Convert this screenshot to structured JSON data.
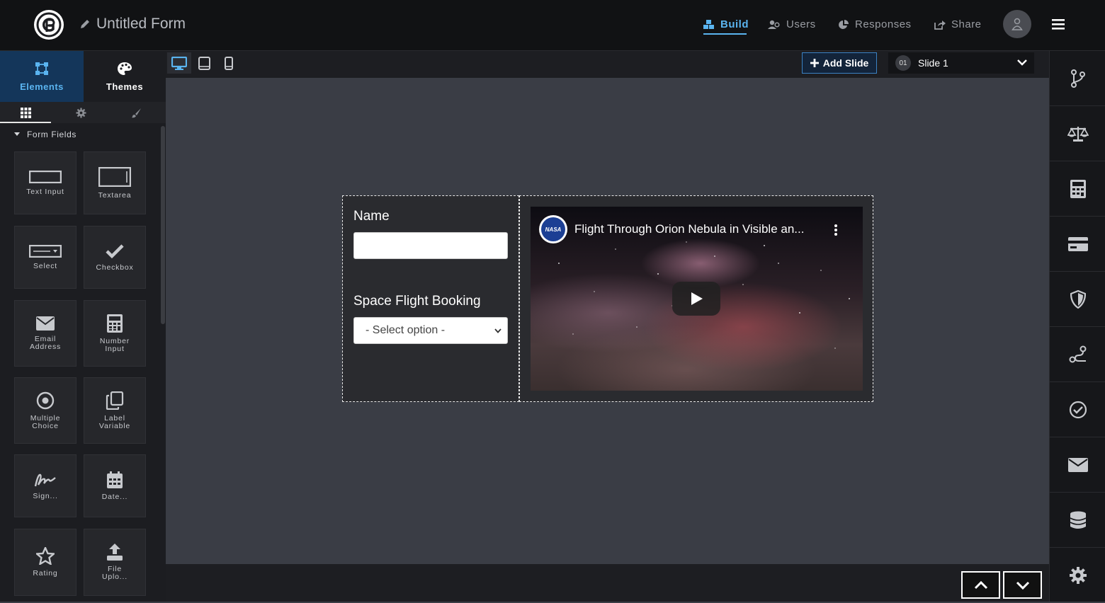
{
  "app": {
    "form_title": "Untitled Form",
    "logo_text": "GP"
  },
  "topnav": {
    "build": "Build",
    "users": "Users",
    "responses": "Responses",
    "share": "Share"
  },
  "left_panel": {
    "tabs": {
      "elements": "Elements",
      "themes": "Themes"
    },
    "section_title": "Form Fields",
    "tiles": [
      {
        "label": "Text Input",
        "icon": "text-input-icon"
      },
      {
        "label": "Textarea",
        "icon": "textarea-icon"
      },
      {
        "label": "Select",
        "icon": "select-icon"
      },
      {
        "label": "Checkbox",
        "icon": "checkbox-icon"
      },
      {
        "label": "Email Address",
        "icon": "email-icon"
      },
      {
        "label": "Number Input",
        "icon": "calculator-icon"
      },
      {
        "label": "Multiple Choice",
        "icon": "radio-icon"
      },
      {
        "label": "Label Variable",
        "icon": "copy-icon"
      },
      {
        "label": "Sign...",
        "icon": "signature-icon"
      },
      {
        "label": "Date...",
        "icon": "calendar-icon"
      },
      {
        "label": "Rating",
        "icon": "star-icon"
      },
      {
        "label": "File Uplo...",
        "icon": "upload-icon"
      }
    ]
  },
  "toolbar": {
    "add_slide": "Add Slide",
    "slide_number": "01",
    "slide_name": "Slide 1"
  },
  "slide": {
    "name_label": "Name",
    "name_value": "",
    "booking_label": "Space Flight Booking",
    "booking_value": "- Select option -",
    "video": {
      "title": "Flight Through Orion Nebula in Visible an...",
      "channel_logo": "NASA"
    }
  },
  "right_sidebar": [
    "branch-icon",
    "scale-icon",
    "calculator-icon",
    "credit-card-icon",
    "shield-icon",
    "route-icon",
    "check-circle-icon",
    "envelope-icon",
    "database-icon",
    "gear-icon"
  ],
  "colors": {
    "accent": "#5ab4f0",
    "topbar": "#111214",
    "canvas": "#3a3d45",
    "panel": "#1c1d21"
  }
}
